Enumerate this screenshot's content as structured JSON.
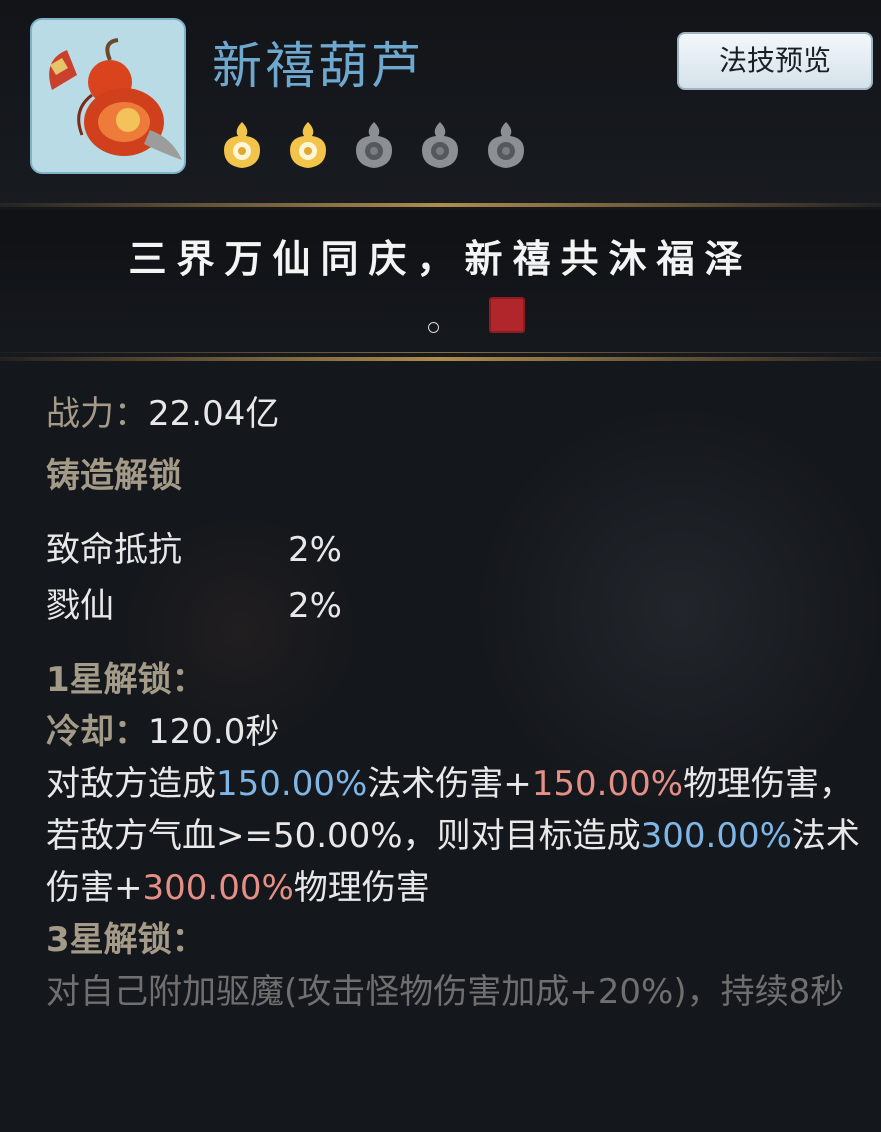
{
  "item": {
    "name": "新禧葫芦",
    "icon": "gourd-icon",
    "stars_total": 5,
    "stars_lit": 2
  },
  "preview_button": {
    "label": "法技预览"
  },
  "motto": "三界万仙同庆，新禧共沐福泽",
  "power": {
    "label": "战力：",
    "value": "22.04亿"
  },
  "forge": {
    "heading": "铸造解锁",
    "attrs": [
      {
        "name": "致命抵抗",
        "value": "2%"
      },
      {
        "name": "戮仙",
        "value": "2%"
      }
    ]
  },
  "star1": {
    "heading": "1星解锁：",
    "cooldown_label": "冷却：",
    "cooldown_value": "120.0秒",
    "desc_parts": [
      "对敌方造成",
      "150.00%",
      "法术伤害+",
      "150.00%",
      "物理伤害，若敌方气血>=50.00%，则对目标造成",
      "300.00%",
      "法术伤害+",
      "300.00%",
      "物理伤害"
    ]
  },
  "star3": {
    "heading": "3星解锁：",
    "desc": "对自己附加驱魔(攻击怪物伤害加成+20%)，持续8秒"
  },
  "colors": {
    "name": "#6fa8cf",
    "magic": "#7fb6e6",
    "physical": "#e58f86",
    "label": "#a49a88",
    "locked": "#6f6f6f",
    "star_lit": "#f2c44a",
    "star_dim": "#8c8f94"
  }
}
